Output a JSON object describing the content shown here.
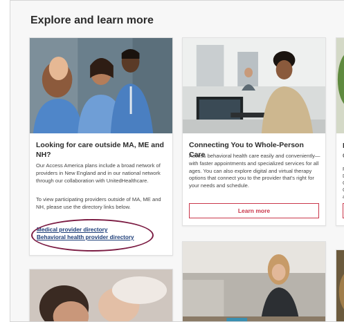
{
  "section": {
    "title": "Explore and learn more"
  },
  "card1": {
    "title": "Looking for care outside MA, ME and NH?",
    "body1": "Our Access America plans include a broad network of providers in New England and in our national network through our collaboration with UnitedHealthcare.",
    "body2": "To view participating providers outside of MA, ME and NH, please use the directory links below.",
    "links": [
      "Medical provider directory",
      "Behavioral health provider directory"
    ]
  },
  "card2": {
    "title": "Connecting You to Whole-Person Care",
    "body": "Access behavioral health care easily and conveniently—with faster appointments and specialized services for all ages. You can also explore digital and virtual therapy options that connect you to the provider that's right for your needs and schedule.",
    "button": "Learn more"
  },
  "card3": {
    "title_initial": "D",
    "subtitle_initial": "G",
    "line_initials": [
      "F",
      "D",
      "C",
      "C",
      "a"
    ]
  },
  "colors": {
    "accent": "#c9364a",
    "link": "#1c3d78",
    "highlight": "#7b1b42"
  }
}
